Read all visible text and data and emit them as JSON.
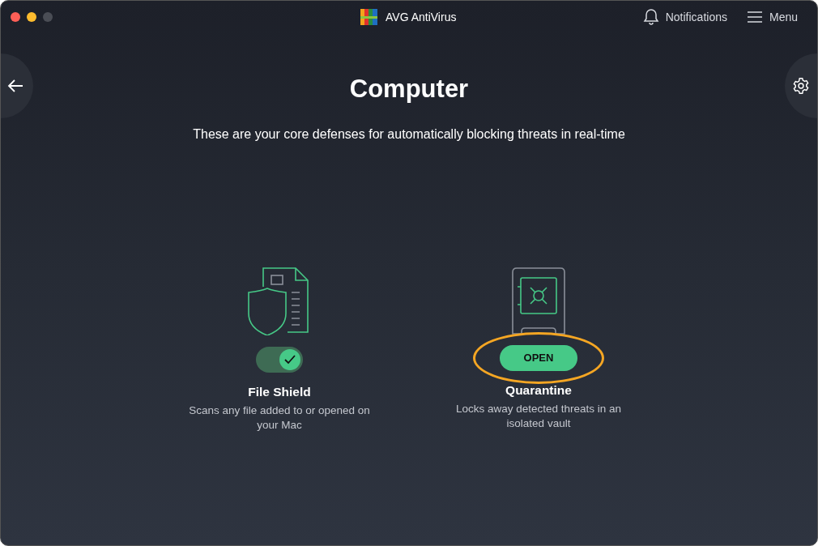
{
  "window": {
    "title": "AVG AntiVirus"
  },
  "header": {
    "notifications": "Notifications",
    "menu": "Menu"
  },
  "page": {
    "title": "Computer",
    "subtitle": "These are your core defenses for automatically blocking threats in real-time"
  },
  "features": [
    {
      "kind": "toggle",
      "name": "File Shield",
      "description": "Scans any file added to or opened on your Mac",
      "on": true,
      "highlighted": false
    },
    {
      "kind": "button",
      "name": "Quarantine",
      "description": "Locks away detected threats in an isolated vault",
      "button_label": "OPEN",
      "highlighted": true
    }
  ]
}
